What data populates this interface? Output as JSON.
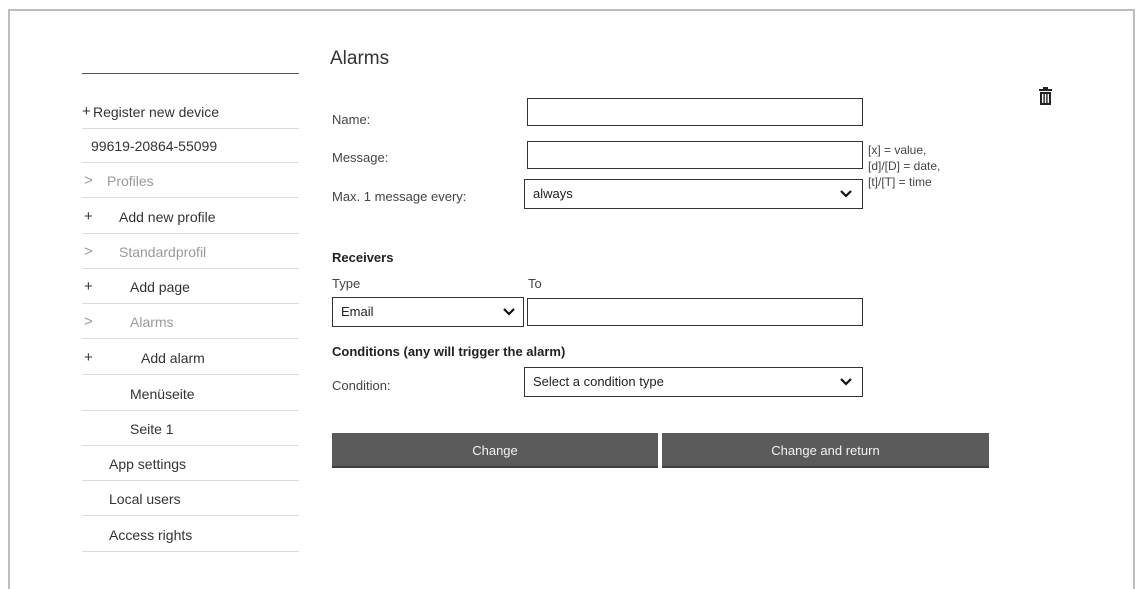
{
  "page": {
    "title": "Alarms"
  },
  "sidebar": {
    "register_glyph": "+",
    "register_label": "Register new device",
    "device_id": "99619-20864-55099",
    "profiles_glyph": ">",
    "profiles_label": "Profiles",
    "add_profile_glyph": "+",
    "add_profile_label": "Add new profile",
    "standardprofil_glyph": ">",
    "standardprofil_label": "Standardprofil",
    "add_page_glyph": "+",
    "add_page_label": "Add page",
    "alarms_glyph": ">",
    "alarms_label": "Alarms",
    "add_alarm_glyph": "+",
    "add_alarm_label": "Add alarm",
    "menu_page_label": "Menüseite",
    "page1_label": "Seite 1",
    "app_settings_label": "App settings",
    "local_users_label": "Local users",
    "access_rights_label": "Access rights"
  },
  "form": {
    "name_label": "Name:",
    "name_value": "",
    "message_label": "Message:",
    "message_value": "",
    "max_label": "Max. 1 message every:",
    "max_value": "always",
    "hint_lines": [
      "[x] = value,",
      "[d]/[D] = date,",
      "[t]/[T] = time"
    ]
  },
  "receivers": {
    "heading": "Receivers",
    "type_header": "Type",
    "to_header": "To",
    "type_value": "Email",
    "to_value": ""
  },
  "conditions": {
    "heading": "Conditions (any will trigger the alarm)",
    "condition_label": "Condition:",
    "condition_value": "Select a condition type"
  },
  "actions": {
    "change_label": "Change",
    "change_return_label": "Change and return"
  },
  "icons": {
    "delete": "trash-icon",
    "dropdown": "chevron-down-icon"
  },
  "colors": {
    "button_bg": "#5b5b5b",
    "muted_text": "#9a9a9a"
  }
}
